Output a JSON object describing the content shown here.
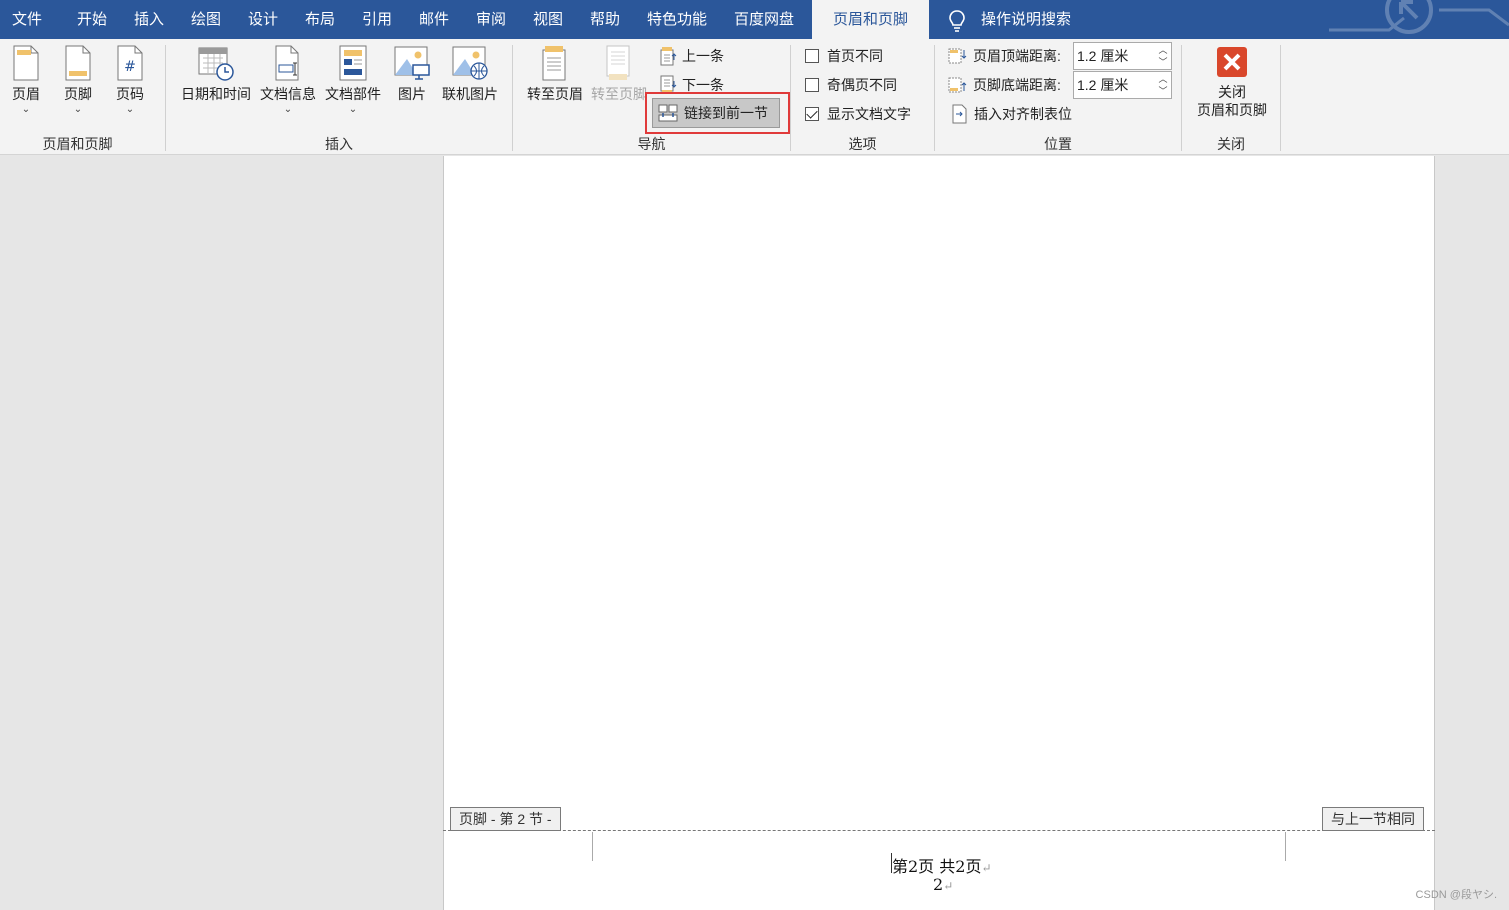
{
  "tabs": [
    "文件",
    "开始",
    "插入",
    "绘图",
    "设计",
    "布局",
    "引用",
    "邮件",
    "审阅",
    "视图",
    "帮助",
    "特色功能",
    "百度网盘",
    "页眉和页脚",
    "操作说明搜索"
  ],
  "ribbon": {
    "hf_group": {
      "header": "页眉",
      "footer": "页脚",
      "page_number": "页码",
      "label": "页眉和页脚"
    },
    "insert_group": {
      "date_time": "日期和时间",
      "doc_info": "文档信息",
      "doc_parts": "文档部件",
      "picture": "图片",
      "online_picture": "联机图片",
      "label": "插入"
    },
    "nav_group": {
      "goto_header": "转至页眉",
      "goto_footer": "转至页脚",
      "previous": "上一条",
      "next": "下一条",
      "link_previous": "链接到前一节",
      "label": "导航"
    },
    "options_group": {
      "different_first": "首页不同",
      "different_odd_even": "奇偶页不同",
      "show_doc_text": "显示文档文字",
      "show_doc_text_checked": true,
      "label": "选项"
    },
    "position_group": {
      "header_from_top_label": "页眉顶端距离:",
      "header_from_top_value": "1.2 厘米",
      "footer_from_bottom_label": "页脚底端距离:",
      "footer_from_bottom_value": "1.2 厘米",
      "insert_align_tab": "插入对齐制表位",
      "label": "位置"
    },
    "close_group": {
      "close_line1": "关闭",
      "close_line2": "页眉和页脚",
      "label": "关闭"
    }
  },
  "document": {
    "footer_section_tag": "页脚 - 第 2 节 -",
    "same_as_previous_tag": "与上一节相同",
    "footer_line1": "第2页  共2页",
    "footer_line2": "2",
    "paragraph_mark": "↵"
  },
  "watermark": "CSDN @段ヤシ.",
  "colors": {
    "tab_bar": "#2b579a",
    "close_icon": "#d9472b",
    "highlight_box": "#e03a3a"
  }
}
